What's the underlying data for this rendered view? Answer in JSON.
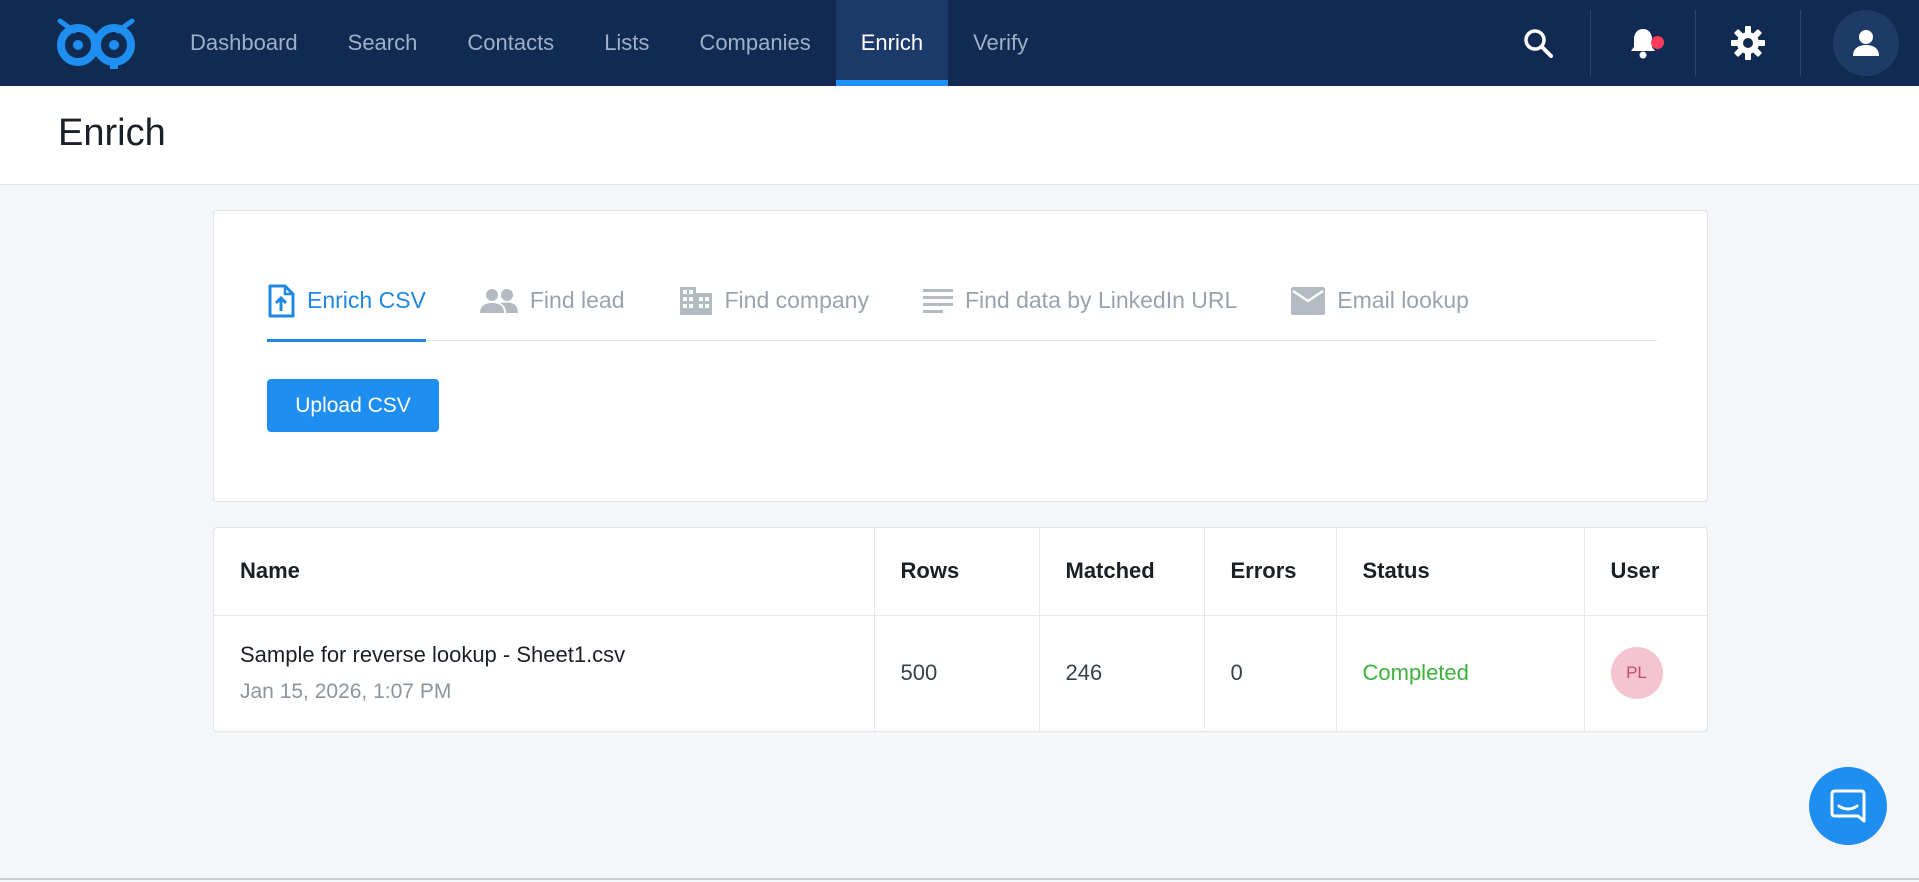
{
  "nav": {
    "items": [
      {
        "label": "Dashboard",
        "active": false
      },
      {
        "label": "Search",
        "active": false
      },
      {
        "label": "Contacts",
        "active": false
      },
      {
        "label": "Lists",
        "active": false
      },
      {
        "label": "Companies",
        "active": false
      },
      {
        "label": "Enrich",
        "active": true
      },
      {
        "label": "Verify",
        "active": false
      }
    ],
    "icons": [
      "search-icon",
      "bell-icon",
      "gear-icon",
      "user-icon"
    ],
    "colors": {
      "background": "#102a52",
      "active_bg": "#1b3a6a",
      "accent": "#1e90ff",
      "notification": "#ff3b5c"
    }
  },
  "page": {
    "title": "Enrich"
  },
  "tabs": [
    {
      "label": "Enrich CSV",
      "icon": "file-upload-icon",
      "active": true
    },
    {
      "label": "Find lead",
      "icon": "people-icon",
      "active": false
    },
    {
      "label": "Find company",
      "icon": "building-icon",
      "active": false
    },
    {
      "label": "Find data by LinkedIn URL",
      "icon": "lines-icon",
      "active": false
    },
    {
      "label": "Email lookup",
      "icon": "envelope-icon",
      "active": false
    }
  ],
  "upload": {
    "label": "Upload CSV"
  },
  "table": {
    "headers": [
      "Name",
      "Rows",
      "Matched",
      "Errors",
      "Status",
      "User"
    ],
    "rows": [
      {
        "name": "Sample for reverse lookup - Sheet1.csv",
        "date": "Jan 15, 2026, 1:07 PM",
        "rows": "500",
        "matched": "246",
        "errors": "0",
        "status": "Completed",
        "user": "PL"
      }
    ]
  },
  "chat": {
    "icon": "chat-icon"
  }
}
